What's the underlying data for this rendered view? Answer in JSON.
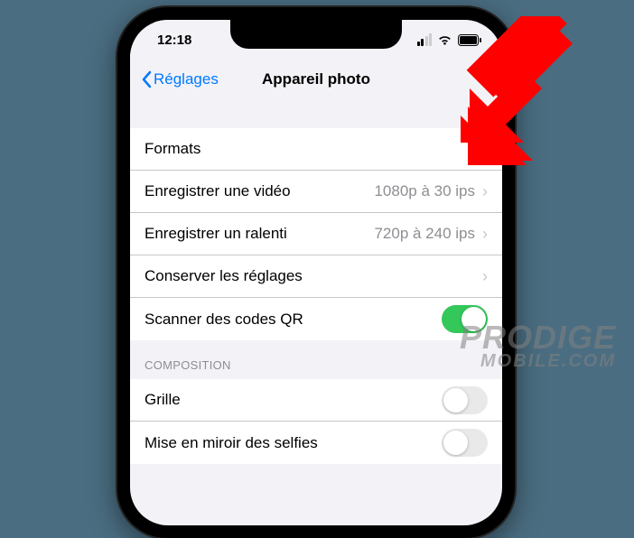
{
  "status": {
    "time": "12:18"
  },
  "nav": {
    "back": "Réglages",
    "title": "Appareil photo"
  },
  "rows": {
    "formats": {
      "label": "Formats"
    },
    "video": {
      "label": "Enregistrer une vidéo",
      "value": "1080p à 30 ips"
    },
    "ralenti": {
      "label": "Enregistrer un ralenti",
      "value": "720p à 240 ips"
    },
    "conserver": {
      "label": "Conserver les réglages"
    },
    "qr": {
      "label": "Scanner des codes QR",
      "on": true
    }
  },
  "section": {
    "composition": "COMPOSITION"
  },
  "comp": {
    "grille": {
      "label": "Grille",
      "on": false
    },
    "miroir": {
      "label": "Mise en miroir des selfies",
      "on": false
    }
  },
  "watermark": {
    "line1": "PRODIGE",
    "line2": "MOBILE.COM"
  }
}
